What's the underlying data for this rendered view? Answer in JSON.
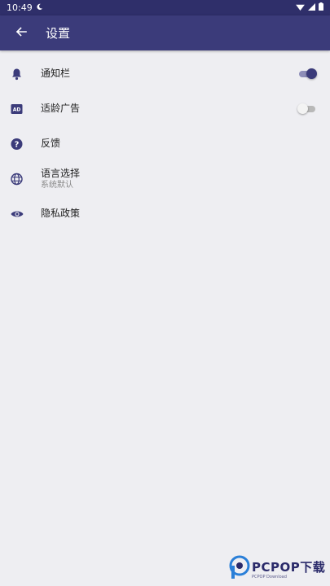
{
  "statusbar": {
    "time": "10:49"
  },
  "appbar": {
    "title": "设置"
  },
  "settings": [
    {
      "label": "通知栏",
      "icon": "bell-icon",
      "toggle": true
    },
    {
      "label": "适龄广告",
      "icon": "ad-icon",
      "toggle": false
    },
    {
      "label": "反馈",
      "icon": "help-icon"
    },
    {
      "label": "语言选择",
      "sublabel": "系统默认",
      "icon": "globe-icon"
    },
    {
      "label": "隐私政策",
      "icon": "eye-icon"
    }
  ],
  "watermark": {
    "text": "PCPOP下载",
    "subtext": "PCPOP Download"
  },
  "colors": {
    "primary": "#3b3b7a",
    "statusbar": "#2f2f6a",
    "background": "#eeeef2",
    "icon": "#3b3b7a"
  }
}
